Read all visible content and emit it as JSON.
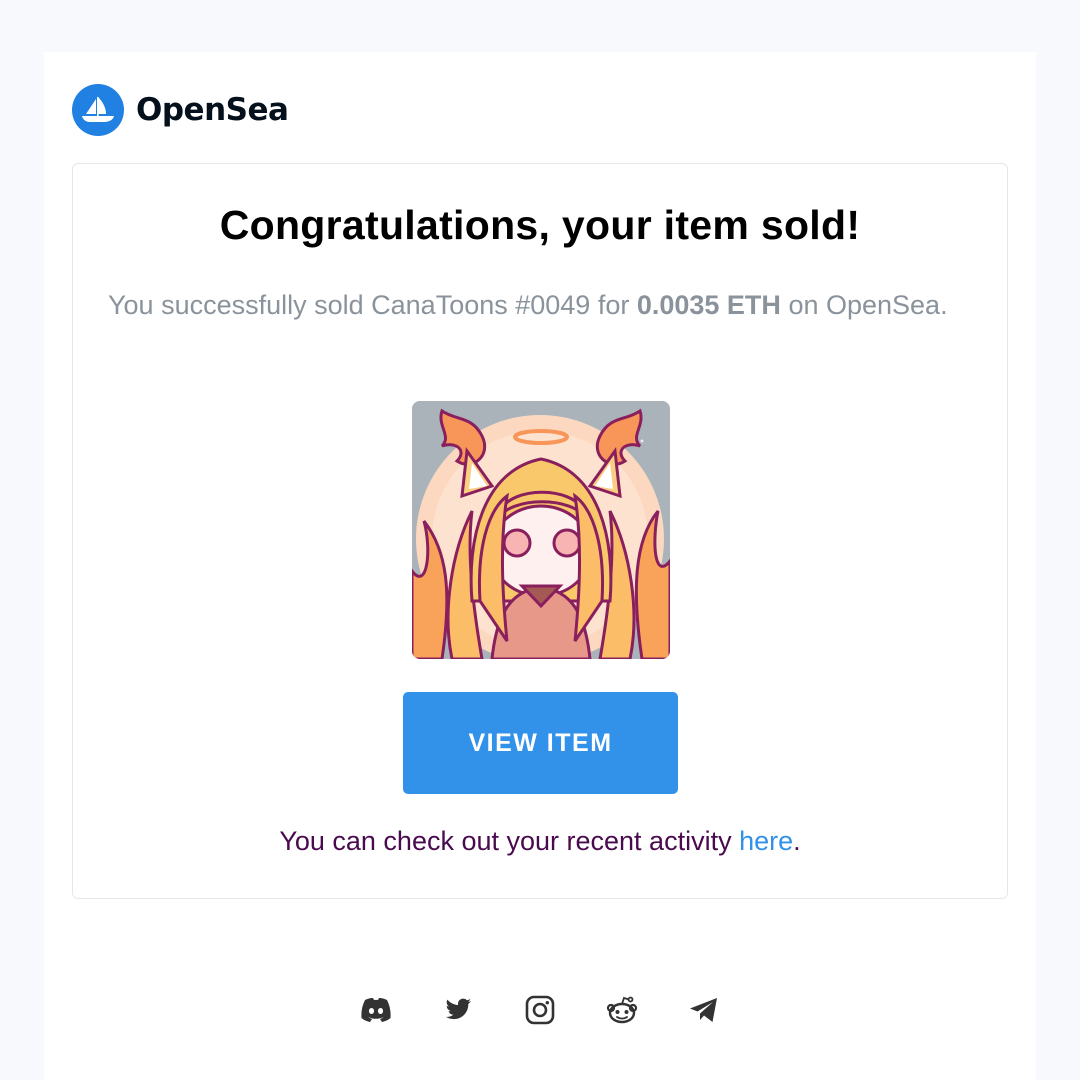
{
  "brand": {
    "name": "OpenSea",
    "color": "#2081e2"
  },
  "card": {
    "heading": "Congratulations, your item sold!",
    "message_prefix": "You successfully sold CanaToons #0049 for ",
    "price": "0.0035 ETH",
    "message_suffix": " on OpenSea.",
    "item_image_icon": "nft-fox-girl-artwork",
    "button_label": "VIEW ITEM",
    "button_color": "#3291e9",
    "activity_prefix": "You can check out your recent activity ",
    "activity_link": "here",
    "activity_suffix": "."
  },
  "socials": [
    {
      "icon": "discord-icon"
    },
    {
      "icon": "twitter-icon"
    },
    {
      "icon": "instagram-icon"
    },
    {
      "icon": "reddit-icon"
    },
    {
      "icon": "telegram-icon"
    }
  ]
}
